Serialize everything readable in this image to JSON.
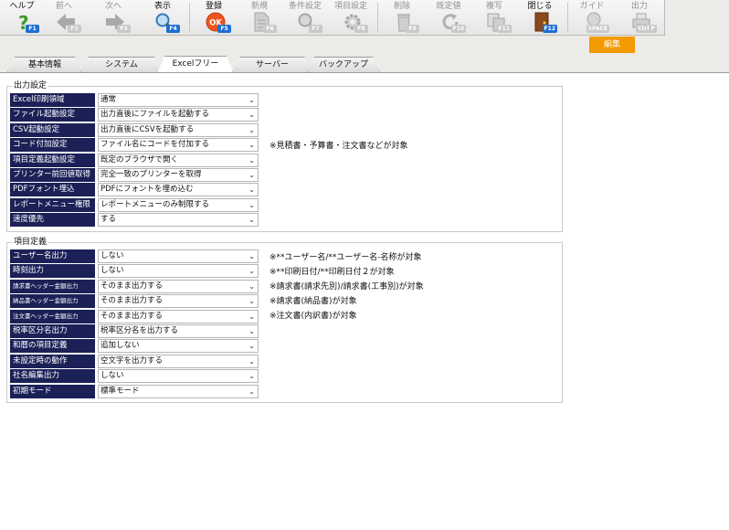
{
  "toolbar": {
    "buttons": [
      {
        "label": "ヘルプ",
        "key": "F1",
        "icon": "help-icon"
      },
      {
        "label": "前へ",
        "key": "F2",
        "icon": "arrow-left-icon"
      },
      {
        "label": "次へ",
        "key": "F3",
        "icon": "arrow-right-icon"
      },
      {
        "label": "表示",
        "key": "F4",
        "icon": "magnifier-icon"
      },
      {
        "label": "登録",
        "key": "F5",
        "icon": "ok-icon"
      },
      {
        "label": "新規",
        "key": "F6",
        "icon": "new-document-icon"
      },
      {
        "label": "条件設定",
        "key": "F7",
        "icon": "search-settings-icon"
      },
      {
        "label": "項目設定",
        "key": "F8",
        "icon": "item-settings-icon"
      },
      {
        "label": "削除",
        "key": "F9",
        "icon": "trash-icon"
      },
      {
        "label": "既定値",
        "key": "F10",
        "icon": "refresh-icon"
      },
      {
        "label": "複写",
        "key": "F11",
        "icon": "copy-icon"
      },
      {
        "label": "閉じる",
        "key": "F12",
        "icon": "door-icon"
      },
      {
        "label": "ガイド",
        "key": "SPACE",
        "icon": "lightbulb-icon"
      },
      {
        "label": "出力",
        "key": "Ctrl P",
        "icon": "printer-icon"
      }
    ],
    "mode_badge": "編集"
  },
  "tabs": [
    "基本情報",
    "システム",
    "Excelフリー",
    "サーバー",
    "バックアップ"
  ],
  "active_tab": "Excelフリー",
  "output_settings": {
    "title": "出力設定",
    "rows": [
      {
        "label": "Excel印刷領域",
        "value": "通常"
      },
      {
        "label": "ファイル起動設定",
        "value": "出力直後にファイルを起動する"
      },
      {
        "label": "CSV起動設定",
        "value": "出力直後にCSVを起動する"
      },
      {
        "label": "コード付加設定",
        "value": "ファイル名にコードを付加する"
      },
      {
        "label": "項目定義起動設定",
        "value": "既定のブラウザで開く"
      },
      {
        "label": "プリンター前回値取得",
        "value": "完全一致のプリンターを取得"
      },
      {
        "label": "PDFフォント埋込",
        "value": "PDFにフォントを埋め込む"
      },
      {
        "label": "レポートメニュー権限",
        "value": "レポートメニューのみ制限する"
      },
      {
        "label": "速度優先",
        "value": "する"
      }
    ],
    "note": "※見積書・予算書・注文書などが対象"
  },
  "item_definition": {
    "title": "項目定義",
    "rows": [
      {
        "label": "ユーザー名出力",
        "value": "しない"
      },
      {
        "label": "時刻出力",
        "value": "しない"
      },
      {
        "label": "請求書ヘッダー金額出力",
        "value": "そのまま出力する"
      },
      {
        "label": "納品書ヘッダー金額出力",
        "value": "そのまま出力する"
      },
      {
        "label": "注文書ヘッダー金額出力",
        "value": "そのまま出力する"
      },
      {
        "label": "税率区分名出力",
        "value": "税率区分名を出力する"
      },
      {
        "label": "和暦の項目定義",
        "value": "追加しない"
      },
      {
        "label": "未設定時の動作",
        "value": "空文字を出力する"
      },
      {
        "label": "社名編集出力",
        "value": "しない"
      },
      {
        "label": "初期モード",
        "value": "標準モード"
      }
    ],
    "notes": [
      "※**ユーザー名/**ユーザー名-名称が対象",
      "※**印刷日付/**印刷日付２が対象",
      "※請求書(請求先別)/請求書(工事別)が対象",
      "※請求書(納品書)が対象",
      "※注文書(内訳書)が対象"
    ]
  },
  "colors": {
    "label_bg": "#1b2157",
    "accent_key": "#1e6fd3",
    "badge": "#f39a00"
  }
}
